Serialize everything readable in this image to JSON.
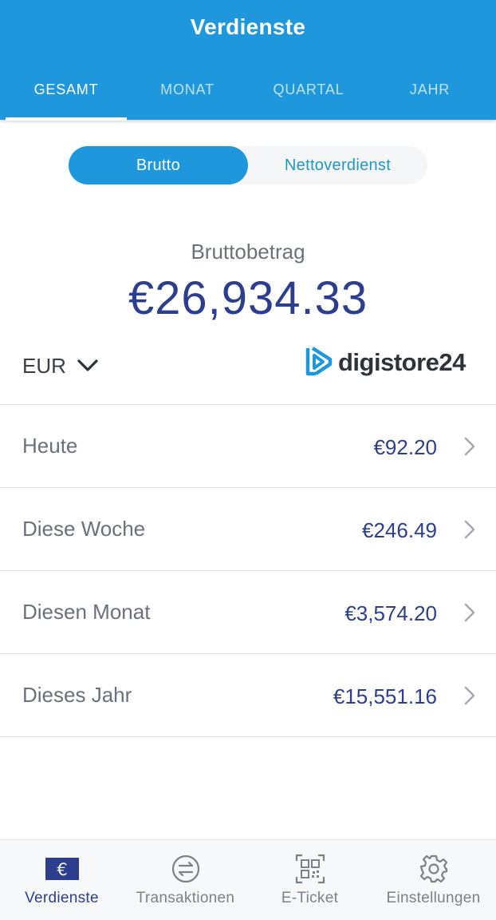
{
  "header": {
    "title": "Verdienste"
  },
  "tabs": [
    {
      "label": "GESAMT",
      "active": true
    },
    {
      "label": "MONAT",
      "active": false
    },
    {
      "label": "QUARTAL",
      "active": false
    },
    {
      "label": "JAHR",
      "active": false
    }
  ],
  "segment": {
    "active_label": "Brutto",
    "inactive_label": "Nettoverdienst"
  },
  "summary": {
    "label": "Bruttobetrag",
    "amount": "€26,934.33"
  },
  "currency": {
    "value": "EUR",
    "icon": "chevron-down-icon"
  },
  "brand": {
    "name": "digistore24",
    "icon": "digistore-logo-icon",
    "color": "#1f97dc"
  },
  "rows": [
    {
      "label": "Heute",
      "value": "€92.20"
    },
    {
      "label": "Diese Woche",
      "value": "€246.49"
    },
    {
      "label": "Diesen Monat",
      "value": "€3,574.20"
    },
    {
      "label": "Dieses Jahr",
      "value": "€15,551.16"
    }
  ],
  "bottom_nav": [
    {
      "label": "Verdienste",
      "icon": "euro-icon",
      "active": true
    },
    {
      "label": "Transaktionen",
      "icon": "transfer-icon",
      "active": false
    },
    {
      "label": "E-Ticket",
      "icon": "qr-code-icon",
      "active": false
    },
    {
      "label": "Einstellungen",
      "icon": "gear-icon",
      "active": false
    }
  ],
  "colors": {
    "primary": "#1f97dc",
    "amount": "#2d3e8e",
    "text": "#6c7078"
  }
}
